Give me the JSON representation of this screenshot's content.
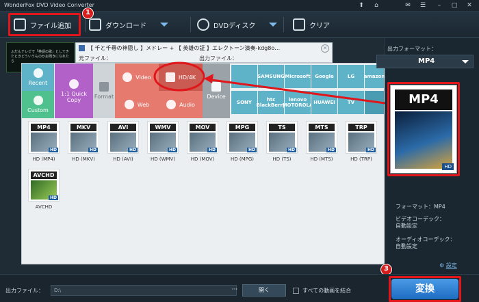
{
  "window": {
    "title": "WonderFox DVD Video Converter"
  },
  "toolbar": {
    "add_files": "ファイル追加",
    "download": "ダウンロード",
    "dvd_disc": "DVDディスク",
    "clear": "クリア"
  },
  "badges": {
    "b1": "1",
    "b2": "2",
    "b3": "3"
  },
  "video": {
    "thumb_text": "ふだんテレビで「英語の歌」としてきたときどういうものかお聞きになれたら",
    "title": "【 千と千尋の神隠し 】メドレー + 【 英雄の証 】エレクトーン演奏-kdg8o…",
    "source_label": "元ファイル：",
    "output_label": "出力ファイル："
  },
  "categories": {
    "recent": "Recent",
    "custom": "Custom",
    "copy": "1:1 Quick Copy",
    "format": "Format",
    "video": "Video",
    "web": "Web",
    "hd4k": "HD/4K",
    "audio": "Audio",
    "device": "Device"
  },
  "brands": [
    "SAMSUNG",
    "Microsoft",
    "Google",
    "LG",
    "amazon",
    "SONY",
    "htc BlackBerry",
    "lenovo MOTOROLA",
    "HUAWEI",
    "TV"
  ],
  "formats": [
    {
      "tag": "MP4",
      "label": "HD (MP4)"
    },
    {
      "tag": "MKV",
      "label": "HD (MKV)"
    },
    {
      "tag": "AVI",
      "label": "HD (AVI)"
    },
    {
      "tag": "WMV",
      "label": "HD (WMV)"
    },
    {
      "tag": "MOV",
      "label": "HD (MOV)"
    },
    {
      "tag": "MPG",
      "label": "HD (MPG)"
    },
    {
      "tag": "TS",
      "label": "HD (TS)"
    },
    {
      "tag": "MTS",
      "label": "HD (MTS)"
    },
    {
      "tag": "TRP",
      "label": "HD (TRP)"
    },
    {
      "tag": "AVCHD",
      "label": "AVCHD"
    }
  ],
  "right": {
    "output_format_label": "出力フォーマット：",
    "selected_format": "MP4",
    "card_title": "MP4",
    "card_hd": "HD",
    "format_line": "フォーマット：MP4",
    "video_codec": "ビデオコーデック：",
    "video_codec_val": "自動設定",
    "audio_codec": "オーディオコーデック：",
    "audio_codec_val": "自動設定",
    "settings": "設定"
  },
  "bottom": {
    "output_label": "出力ファイル：",
    "output_path": "D:\\",
    "more": "···",
    "open": "開く",
    "merge": "すべての動画を結合",
    "convert": "変換"
  },
  "colors": {
    "highlight": "#e0161a",
    "accent": "#7fb7e6",
    "tile_recent": "#5fb3c9",
    "tile_custom": "#4fc18f",
    "tile_copy": "#b261c8",
    "tile_video": "#e77a6f",
    "tile_device": "#9ca3a8"
  }
}
